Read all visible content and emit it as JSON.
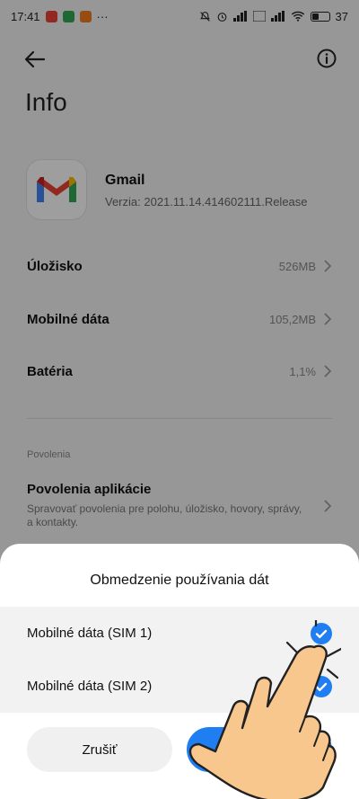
{
  "status_bar": {
    "time": "17:41",
    "more": "···",
    "battery_percent": "37"
  },
  "page": {
    "title": "Info"
  },
  "app": {
    "name": "Gmail",
    "version": "Verzia: 2021.11.14.414602111.Release",
    "icon": "gmail-icon"
  },
  "rows": [
    {
      "label": "Úložisko",
      "value": "526MB"
    },
    {
      "label": "Mobilné dáta",
      "value": "105,2MB"
    },
    {
      "label": "Batéria",
      "value": "1,1%"
    }
  ],
  "permissions": {
    "section_label": "Povolenia",
    "title": "Povolenia aplikácie",
    "description": "Spravovať povolenia pre polohu, úložisko, hovory, správy, a kontakty."
  },
  "sheet": {
    "title": "Obmedzenie používania dát",
    "options": [
      {
        "label": "Mobilné dáta (SIM 1)",
        "checked": true
      },
      {
        "label": "Mobilné dáta (SIM 2)",
        "checked": true
      }
    ],
    "cancel_label": "Zrušiť",
    "ok_label": ""
  },
  "colors": {
    "accent": "#1f7ef2",
    "sheet_bg": "#ffffff",
    "hand": "#f7c78e"
  }
}
